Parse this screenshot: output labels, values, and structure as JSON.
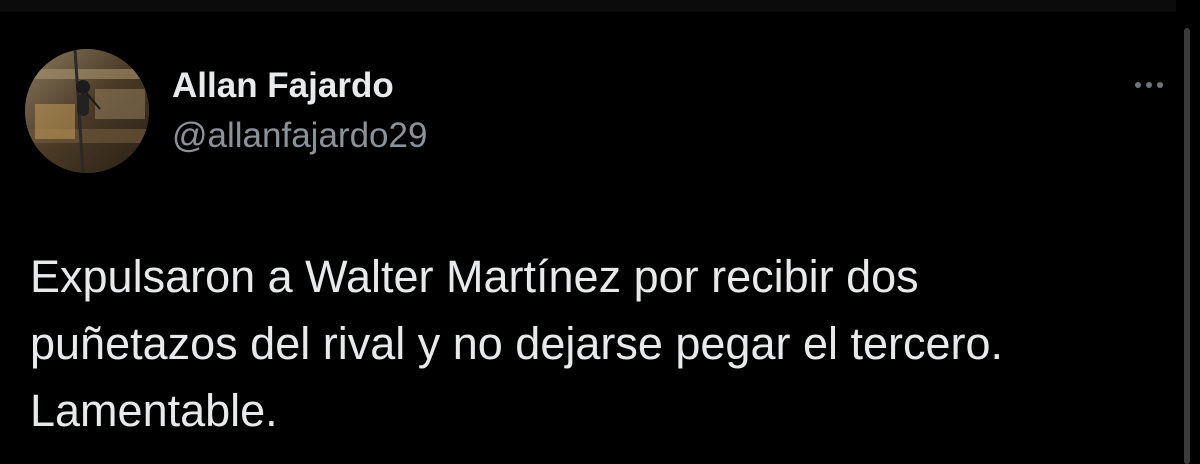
{
  "author": {
    "display_name": "Allan Fajardo",
    "handle": "@allanfajardo29",
    "avatar_icon": "profile-photo"
  },
  "actions": {
    "more_icon": "ellipsis-icon"
  },
  "tweet": {
    "lines": [
      "Expulsaron a Walter Martínez por recibir dos",
      "puñetazos del rival y no dejarse pegar el tercero.",
      "Lamentable."
    ]
  },
  "colors": {
    "background": "#000000",
    "primary_text": "#e7e9ea",
    "secondary_text": "#8b9298"
  }
}
